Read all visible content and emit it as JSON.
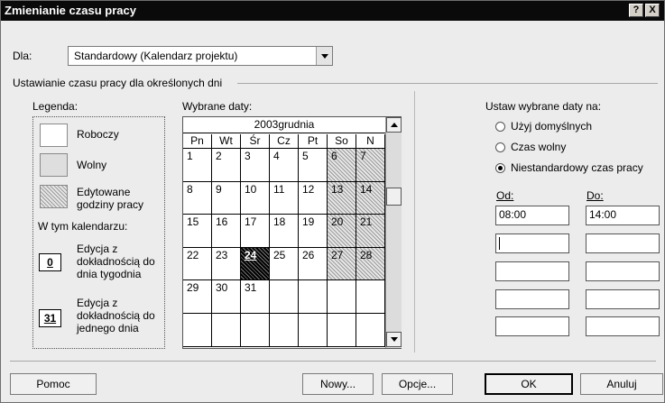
{
  "dialog": {
    "title": "Zmienianie czasu pracy",
    "help_btn": "?",
    "close_btn": "X"
  },
  "for_row": {
    "label": "Dla:",
    "calendar": "Standardowy (Kalendarz projektu)"
  },
  "section_title": "Ustawianie czasu pracy dla określonych dni",
  "legend": {
    "title": "Legenda:",
    "items": [
      "Roboczy",
      "Wolny",
      "Edytowane godziny pracy"
    ],
    "in_calendar_title": "W tym kalendarzu:",
    "weekday_box": "0",
    "weekday_edit": "Edycja z dokładnością do dnia tygodnia",
    "day_box": "31",
    "day_edit": "Edycja z dokładnością do jednego dnia"
  },
  "calendar": {
    "label": "Wybrane daty:",
    "month": "2003grudnia",
    "day_headers": [
      "Pn",
      "Wt",
      "Śr",
      "Cz",
      "Pt",
      "So",
      "N"
    ],
    "weeks": [
      [
        "1",
        "2",
        "3",
        "4",
        "5",
        "6",
        "7"
      ],
      [
        "8",
        "9",
        "10",
        "11",
        "12",
        "13",
        "14"
      ],
      [
        "15",
        "16",
        "17",
        "18",
        "19",
        "20",
        "21"
      ],
      [
        "22",
        "23",
        "24",
        "25",
        "26",
        "27",
        "28"
      ],
      [
        "29",
        "30",
        "31",
        "",
        "",
        "",
        ""
      ],
      [
        "",
        "",
        "",
        "",
        "",
        "",
        ""
      ]
    ],
    "selected_day": "24"
  },
  "set_dates": {
    "title": "Ustaw wybrane daty na:",
    "options": [
      "Użyj domyślnych",
      "Czas wolny",
      "Niestandardowy czas pracy"
    ],
    "selected_option": "Niestandardowy czas pracy",
    "from_label": "Od:",
    "to_label": "Do:",
    "rows": [
      {
        "from": "08:00",
        "to": "14:00"
      },
      {
        "from": "",
        "to": ""
      },
      {
        "from": "",
        "to": ""
      },
      {
        "from": "",
        "to": ""
      },
      {
        "from": "",
        "to": ""
      }
    ]
  },
  "buttons": {
    "help": "Pomoc",
    "new": "Nowy...",
    "options": "Opcje...",
    "ok": "OK",
    "cancel": "Anuluj"
  }
}
